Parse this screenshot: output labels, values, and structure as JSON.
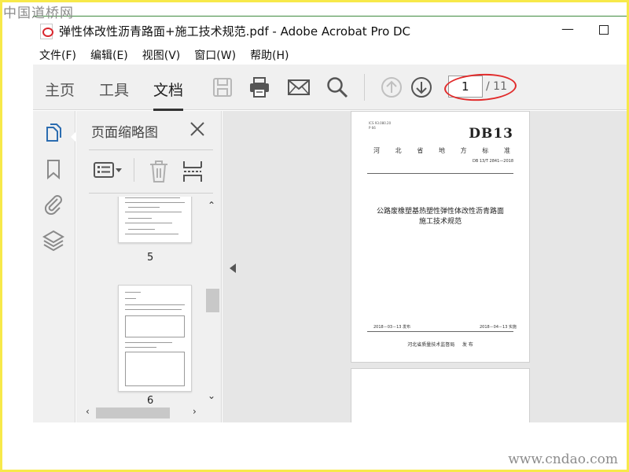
{
  "watermark_top": "中国道桥网",
  "watermark_bottom": "www.cndao.com",
  "window": {
    "title": "弹性体改性沥青路面+施工技术规范.pdf - Adobe Acrobat Pro DC"
  },
  "menu": [
    "文件(F)",
    "编辑(E)",
    "视图(V)",
    "窗口(W)",
    "帮助(H)"
  ],
  "toolbar": {
    "tabs": [
      "主页",
      "工具",
      "文档"
    ],
    "active_tab": "文档",
    "page_current": "1",
    "page_total": "/ 11",
    "icons": [
      "save-icon",
      "print-icon",
      "email-icon",
      "search-icon",
      "page-up-icon",
      "page-down-icon"
    ]
  },
  "rail": {
    "icons": [
      "page-thumbnails-icon",
      "bookmark-icon",
      "attachment-icon",
      "layers-icon"
    ]
  },
  "panel": {
    "title": "页面缩略图",
    "thumbnails": [
      {
        "label": "5"
      },
      {
        "label": "6"
      }
    ]
  },
  "document": {
    "page1": {
      "header_codes": [
        "ICS 93.080.20",
        "P 66"
      ],
      "code": "DB13",
      "standard_type": [
        "河",
        "北",
        "省",
        "地",
        "方",
        "标",
        "准"
      ],
      "number": "DB 13/T 2841—2018",
      "title_line1": "公路废橡塑基热塑性弹性体改性沥青路面",
      "title_line2": "施工技术规范",
      "release_date": "2018－03－13 发布",
      "impl_date": "2018－04－13 实施",
      "publisher": "河北省质量技术监督局",
      "publisher_suffix": "发 布"
    }
  },
  "colors": {
    "frame": "#f7e94a",
    "annotation": "#e12b2b",
    "toolbar_bg": "#f0f0f0",
    "doc_bg": "#e6e6e6",
    "accent_blue": "#2b6cb0"
  }
}
